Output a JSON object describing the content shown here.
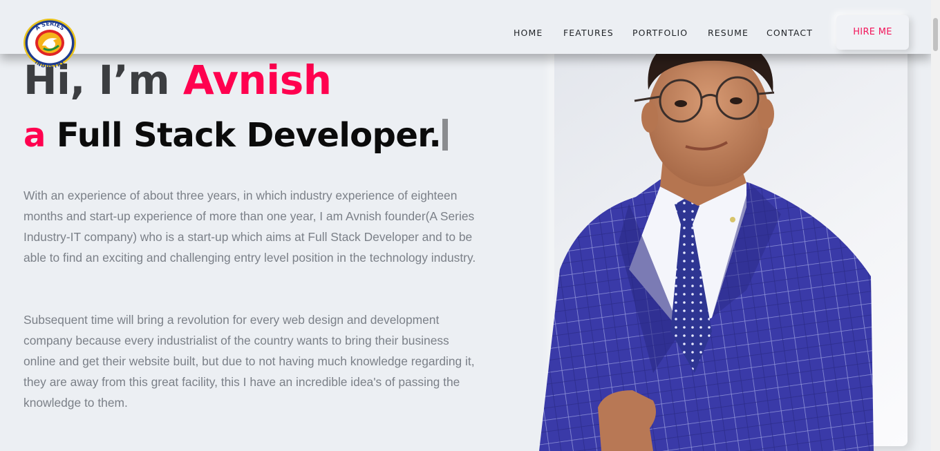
{
  "header": {
    "logo_icon": "a-series-industry-logo",
    "logo_text_top": "A SERIES",
    "logo_text_bottom": "INDUSTRY",
    "nav": [
      {
        "label": "HOME"
      },
      {
        "label": "FEATURES"
      },
      {
        "label": "PORTFOLIO"
      },
      {
        "label": "RESUME"
      },
      {
        "label": "CONTACT"
      }
    ],
    "hire_label": "HIRE ME"
  },
  "hero": {
    "greeting": "Hi, I’m ",
    "name": "Avnish",
    "sub_prefix": "a ",
    "role": "Full Stack Developer.",
    "paragraph_1": "With an experience of about three years, in which industry experience of eighteen months and start-up experience of more than one year, I am Avnish founder(A Series Industry-IT company) who is a start-up which aims at Full Stack Developer and to be able to find an exciting and challenging entry level position in the technology industry.",
    "paragraph_2": "Subsequent time will bring a revolution for every web design and development company because every industrialist of the country wants to bring their business online and get their website built, but due to not having much knowledge regarding it, they are away from this great facility, this I have an incredible idea's of passing the knowledge to them."
  },
  "colors": {
    "accent": "#ff014f",
    "background": "#eceff3",
    "heading": "#3c3e41",
    "body_text": "#7b8088"
  },
  "portrait": {
    "icon": "person-portrait"
  }
}
